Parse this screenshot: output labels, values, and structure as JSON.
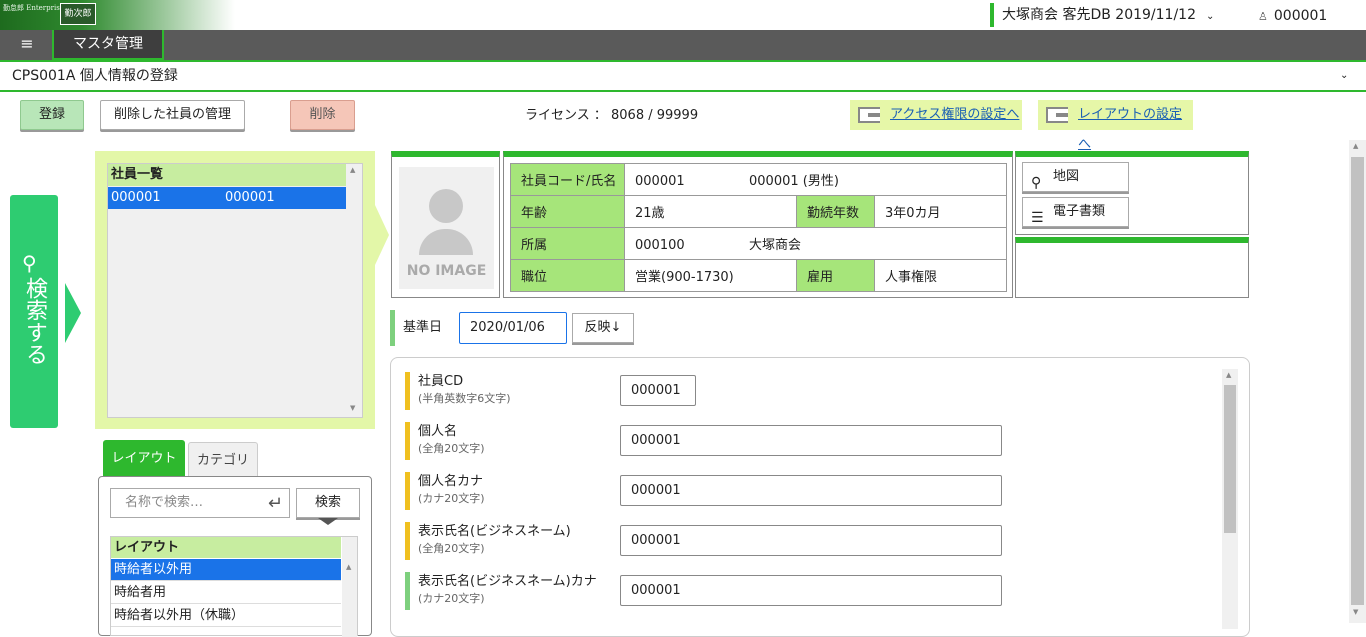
{
  "header": {
    "logo_sub": "勤怠郎 Enterprise",
    "logo_mark": "勤次郎",
    "tenant": "大塚商会 客先DB 2019/11/12",
    "user": "000001"
  },
  "nav": {
    "menu_icon": "≡",
    "tab": "マスタ管理"
  },
  "screen": {
    "title": "CPS001A 個人情報の登録"
  },
  "toolbar": {
    "register": "登録",
    "manage_deleted": "削除した社員の管理",
    "delete": "削除",
    "license": "ライセンス ： 8068 / 99999",
    "access_link": "アクセス権限の設定へ",
    "layout_link": "レイアウトの設定へ"
  },
  "search_tab": {
    "label": "検索する"
  },
  "employee_list": {
    "header": "社員一覧",
    "rows": [
      {
        "code": "000001",
        "name": "000001"
      }
    ]
  },
  "layout_panel": {
    "tabs": [
      "レイアウト",
      "カテゴリ"
    ],
    "search_placeholder": "名称で検索…",
    "search_button": "検索",
    "list_header": "レイアウト",
    "items": [
      "時給者以外用",
      "時給者用",
      "時給者以外用（休職）"
    ]
  },
  "employee_card": {
    "no_image": "NO IMAGE",
    "labels": {
      "code_name": "社員コード/氏名",
      "age": "年齢",
      "tenure": "勤続年数",
      "dept": "所属",
      "position": "職位",
      "employment": "雇用"
    },
    "values": {
      "code": "000001",
      "name": "000001 (男性)",
      "age": "21歳",
      "tenure": "3年0カ月",
      "dept_code": "000100",
      "dept_name": "大塚商会",
      "position": "営業(900-1730)",
      "employment": "人事権限"
    },
    "map_button": "地図",
    "doc_button": "電子書類"
  },
  "date_row": {
    "label": "基準日",
    "value": "2020/01/06",
    "apply": "反映↓"
  },
  "form": {
    "fields": [
      {
        "label": "社員CD",
        "hint": "(半角英数字6文字)",
        "value": "000001",
        "accent": "#f0c020"
      },
      {
        "label": "個人名",
        "hint": "(全角20文字)",
        "value": "000001",
        "accent": "#f0c020"
      },
      {
        "label": "個人名カナ",
        "hint": "(カナ20文字)",
        "value": "000001",
        "accent": "#f0c020"
      },
      {
        "label": "表示氏名(ビジネスネーム)",
        "hint": "(全角20文字)",
        "value": "000001",
        "accent": "#f0c020"
      },
      {
        "label": "表示氏名(ビジネスネーム)カナ",
        "hint": "(カナ20文字)",
        "value": "000001",
        "accent": "#7ed07e"
      }
    ]
  },
  "colors": {
    "brand_green": "#2eb82e",
    "search_green": "#2ecc71",
    "panel_lime": "#e3f7a8",
    "selection_blue": "#1a73e8",
    "label_green": "#a6e57a",
    "required_accent": "#f0c020"
  }
}
